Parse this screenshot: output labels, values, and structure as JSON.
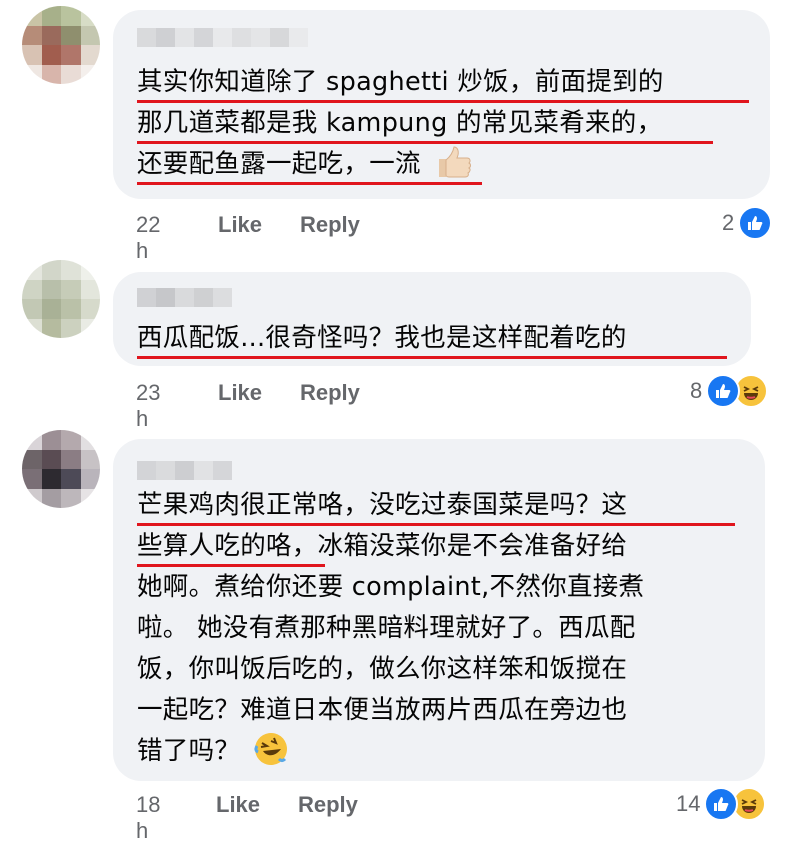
{
  "comments": [
    {
      "lines": [
        "其实你知道除了 spaghetti 炒饭，前面提到的",
        "那几道菜都是我 kampung 的常见菜肴来的，",
        "还要配鱼露一起吃，一流"
      ],
      "trailing_emoji": "thumbs-up",
      "time": "22 h",
      "like_label": "Like",
      "reply_label": "Reply",
      "reaction_count": "2",
      "reactions": [
        "like"
      ]
    },
    {
      "lines": [
        "西瓜配饭...很奇怪吗？我也是这样配着吃的"
      ],
      "trailing_emoji": "",
      "time": "23 h",
      "like_label": "Like",
      "reply_label": "Reply",
      "reaction_count": "8",
      "reactions": [
        "like",
        "haha"
      ]
    },
    {
      "lines": [
        "芒果鸡肉很正常咯，没吃过泰国菜是吗？这",
        "些算人吃的咯，冰箱没菜你是不会准备好给",
        "她啊。煮给你还要 complaint,不然你直接煮",
        "啦。 她没有煮那种黑暗料理就好了。西瓜配",
        "饭，你叫饭后吃的，做么你这样笨和饭搅在",
        "一起吃？难道日本便当放两片西瓜在旁边也",
        "错了吗？"
      ],
      "trailing_emoji": "rolling-on-floor-laughing",
      "time": "18 h",
      "like_label": "Like",
      "reply_label": "Reply",
      "reaction_count": "14",
      "reactions": [
        "like",
        "haha"
      ]
    }
  ],
  "colors": {
    "bubble": "#f0f2f5",
    "underline": "#e0151d",
    "meta": "#65676b",
    "like_blue": "#1877f2",
    "haha_yellow": "#f7c33c"
  }
}
